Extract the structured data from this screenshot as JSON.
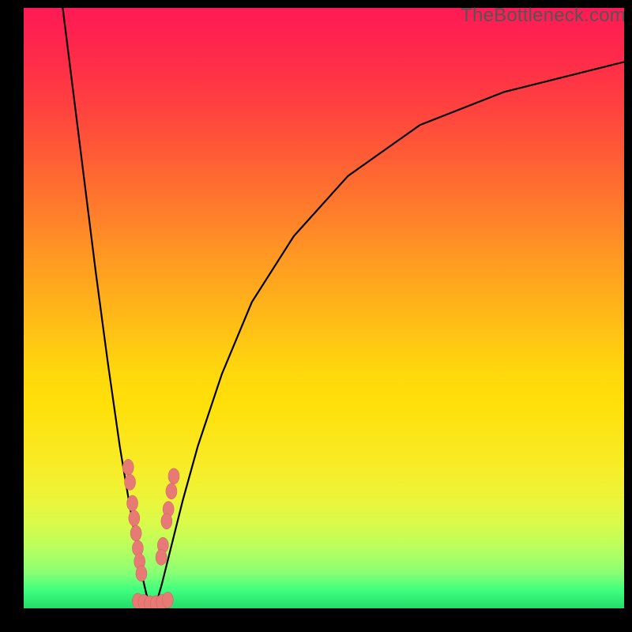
{
  "watermark": "TheBottleneck.com",
  "colors": {
    "frame": "#000000",
    "gradient_top": "#ff1a55",
    "gradient_bottom": "#24db6a",
    "curve": "#000000",
    "bead_fill": "#e87a75",
    "bead_stroke": "#c8605c"
  },
  "chart_data": {
    "type": "line",
    "title": "",
    "xlabel": "",
    "ylabel": "",
    "xlim": [
      0,
      100
    ],
    "ylim": [
      0,
      100
    ],
    "note": "Two curves descending from top into a sharp V near x≈21, y≈0; right curve rises again toward upper right. Values estimated from pixel positions on a 0–100 normalized grid.",
    "series": [
      {
        "name": "left-arm",
        "x": [
          6.5,
          8,
          10,
          12,
          14,
          16,
          17.5,
          18.8,
          19.6,
          20.4,
          21
        ],
        "y": [
          100,
          88,
          72,
          56,
          41,
          27,
          18,
          10.5,
          6,
          2.5,
          0.5
        ]
      },
      {
        "name": "right-arm",
        "x": [
          22,
          23,
          24.5,
          26.5,
          29,
          33,
          38,
          45,
          54,
          66,
          80,
          100
        ],
        "y": [
          0.5,
          4,
          10,
          18,
          27,
          39,
          51,
          62,
          72,
          80.5,
          86,
          91
        ]
      }
    ],
    "markers": {
      "name": "beads",
      "note": "Clustered pink oval markers near the valley on both arms and along the bottom.",
      "points": [
        {
          "x": 17.4,
          "y": 23.5
        },
        {
          "x": 17.7,
          "y": 21.0
        },
        {
          "x": 18.1,
          "y": 17.5
        },
        {
          "x": 18.4,
          "y": 15.0
        },
        {
          "x": 18.7,
          "y": 12.5
        },
        {
          "x": 19.0,
          "y": 10.0
        },
        {
          "x": 19.3,
          "y": 7.8
        },
        {
          "x": 19.6,
          "y": 5.8
        },
        {
          "x": 25.0,
          "y": 22.0
        },
        {
          "x": 24.6,
          "y": 19.5
        },
        {
          "x": 24.1,
          "y": 16.5
        },
        {
          "x": 23.8,
          "y": 14.5
        },
        {
          "x": 23.2,
          "y": 10.5
        },
        {
          "x": 22.9,
          "y": 8.5
        },
        {
          "x": 19.0,
          "y": 1.2
        },
        {
          "x": 20.0,
          "y": 1.0
        },
        {
          "x": 21.0,
          "y": 0.8
        },
        {
          "x": 22.0,
          "y": 0.8
        },
        {
          "x": 23.0,
          "y": 1.0
        },
        {
          "x": 24.0,
          "y": 1.4
        }
      ]
    }
  }
}
